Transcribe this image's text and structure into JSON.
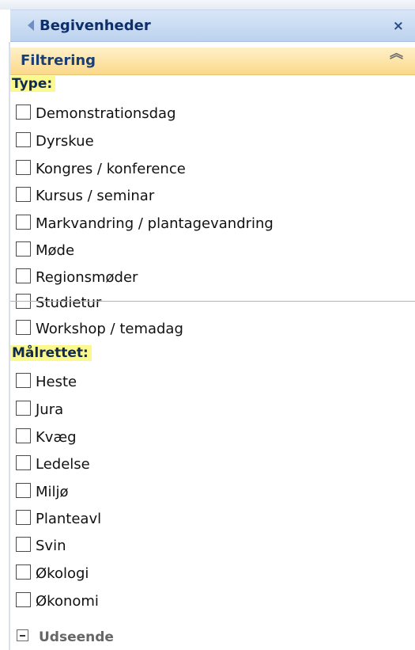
{
  "panel": {
    "title": "Begivenheder",
    "close_glyph": "×",
    "collapse_glyph": "◂"
  },
  "filter": {
    "title": "Filtrering",
    "toggle_glyph": "︽",
    "type_label": "Type:",
    "type_options": [
      "Demonstrationsdag",
      "Dyrskue",
      "Kongres / konference",
      "Kursus / seminar",
      "Markvandring / plantagevandring",
      "Møde",
      "Regionsmøder",
      "Studietur",
      "Workshop / temadag"
    ],
    "target_label": "Målrettet:",
    "target_options": [
      "Heste",
      "Jura",
      "Kvæg",
      "Ledelse",
      "Miljø",
      "Planteavl",
      "Svin",
      "Økologi",
      "Økonomi"
    ]
  },
  "footer": {
    "label": "Udseende",
    "toggle_glyph": "−"
  }
}
